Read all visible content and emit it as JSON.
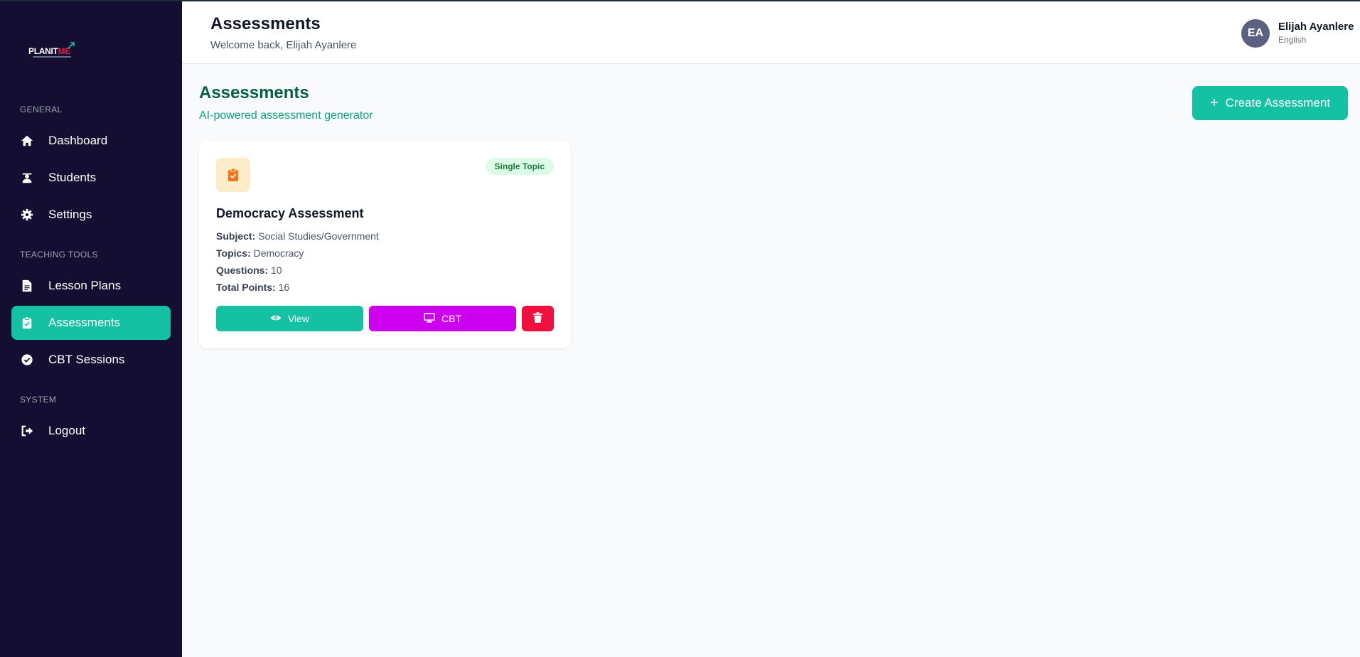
{
  "brand": {
    "logo_text_main": "PLANIT",
    "logo_text_accent": "ME"
  },
  "sidebar": {
    "sections": [
      {
        "label": "GENERAL"
      },
      {
        "label": "TEACHING TOOLS"
      },
      {
        "label": "SYSTEM"
      }
    ],
    "items": [
      {
        "label": "Dashboard",
        "icon": "home-icon",
        "active": false
      },
      {
        "label": "Students",
        "icon": "student-icon",
        "active": false
      },
      {
        "label": "Settings",
        "icon": "gear-icon",
        "active": false
      },
      {
        "label": "Lesson Plans",
        "icon": "document-icon",
        "active": false
      },
      {
        "label": "Assessments",
        "icon": "clipboard-check-icon",
        "active": true
      },
      {
        "label": "CBT Sessions",
        "icon": "check-circle-icon",
        "active": false
      },
      {
        "label": "Logout",
        "icon": "logout-icon",
        "active": false
      }
    ]
  },
  "header": {
    "title": "Assessments",
    "subtitle": "Welcome back, Elijah Ayanlere",
    "user": {
      "initials": "EA",
      "name": "Elijah Ayanlere",
      "language": "English"
    }
  },
  "main": {
    "title": "Assessments",
    "subtitle": "AI-powered assessment generator",
    "create_label": "Create Assessment"
  },
  "assessments": [
    {
      "badge": "Single Topic",
      "title": "Democracy Assessment",
      "subject_label": "Subject:",
      "subject": "Social Studies/Government",
      "topics_label": "Topics:",
      "topics": "Democracy",
      "questions_label": "Questions:",
      "questions": "10",
      "points_label": "Total Points:",
      "points": "16",
      "view_label": "View",
      "cbt_label": "CBT"
    }
  ],
  "colors": {
    "sidebar_bg": "#140f32",
    "accent": "#14c2a3",
    "cbt": "#cc00ee",
    "danger": "#f00f3d",
    "badge_bg": "#dcfce7",
    "badge_text": "#15803d"
  }
}
